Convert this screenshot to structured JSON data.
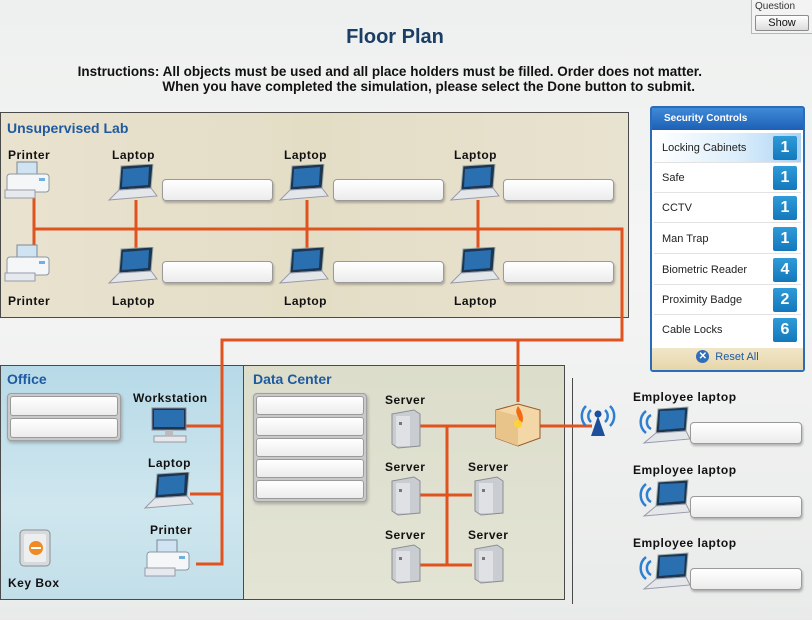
{
  "header": {
    "question_label": "Question",
    "show_button": "Show",
    "title": "Floor Plan",
    "instructions_line1": "Instructions: All objects must be used and all place holders must be filled. Order does not matter.",
    "instructions_line2": "When you have completed the simulation, please select the Done button to submit."
  },
  "zones": {
    "lab": {
      "title": "Unsupervised Lab",
      "devices": [
        {
          "label": "Printer",
          "type": "printer-icon"
        },
        {
          "label": "Laptop",
          "type": "laptop-icon"
        },
        {
          "label": "Laptop",
          "type": "laptop-icon"
        },
        {
          "label": "Laptop",
          "type": "laptop-icon"
        },
        {
          "label": "Printer",
          "type": "printer-icon"
        },
        {
          "label": "Laptop",
          "type": "laptop-icon"
        },
        {
          "label": "Laptop",
          "type": "laptop-icon"
        },
        {
          "label": "Laptop",
          "type": "laptop-icon"
        }
      ],
      "slots": [
        "",
        "",
        "",
        "",
        "",
        ""
      ]
    },
    "office": {
      "title": "Office",
      "devices": [
        {
          "label": "Workstation",
          "type": "workstation-icon"
        },
        {
          "label": "Laptop",
          "type": "laptop-icon"
        },
        {
          "label": "Printer",
          "type": "printer-icon"
        },
        {
          "label": "Key Box",
          "type": "key-box-icon"
        }
      ],
      "slots": [
        "",
        ""
      ]
    },
    "data_center": {
      "title": "Data Center",
      "devices": [
        {
          "label": "Server",
          "type": "server-icon"
        },
        {
          "label": "Server",
          "type": "server-icon"
        },
        {
          "label": "Server",
          "type": "server-icon"
        },
        {
          "label": "Server",
          "type": "server-icon"
        },
        {
          "label": "Server",
          "type": "server-icon"
        }
      ],
      "firewall": "firewall-icon",
      "slots": [
        "",
        "",
        "",
        "",
        ""
      ]
    },
    "wireless": {
      "access_point": "wireless-access-point-icon",
      "devices": [
        {
          "label": "Employee laptop",
          "type": "wireless-laptop-icon"
        },
        {
          "label": "Employee laptop",
          "type": "wireless-laptop-icon"
        },
        {
          "label": "Employee laptop",
          "type": "wireless-laptop-icon"
        }
      ],
      "slots": [
        "",
        "",
        ""
      ]
    }
  },
  "security_controls": {
    "title": "Security Controls",
    "items": [
      {
        "name": "Locking Cabinets",
        "count": "1",
        "selected": true
      },
      {
        "name": "Safe",
        "count": "1"
      },
      {
        "name": "CCTV",
        "count": "1"
      },
      {
        "name": "Man Trap",
        "count": "1"
      },
      {
        "name": "Biometric Reader",
        "count": "4"
      },
      {
        "name": "Proximity Badge",
        "count": "2"
      },
      {
        "name": "Cable Locks",
        "count": "6"
      }
    ],
    "reset_label": "Reset  All"
  },
  "colors": {
    "wire": "#e0531f",
    "title": "#1a3e64",
    "zone_title": "#1f5aa0",
    "panel_blue": "#2b6cb8",
    "count_badge": "#1f86c9"
  }
}
